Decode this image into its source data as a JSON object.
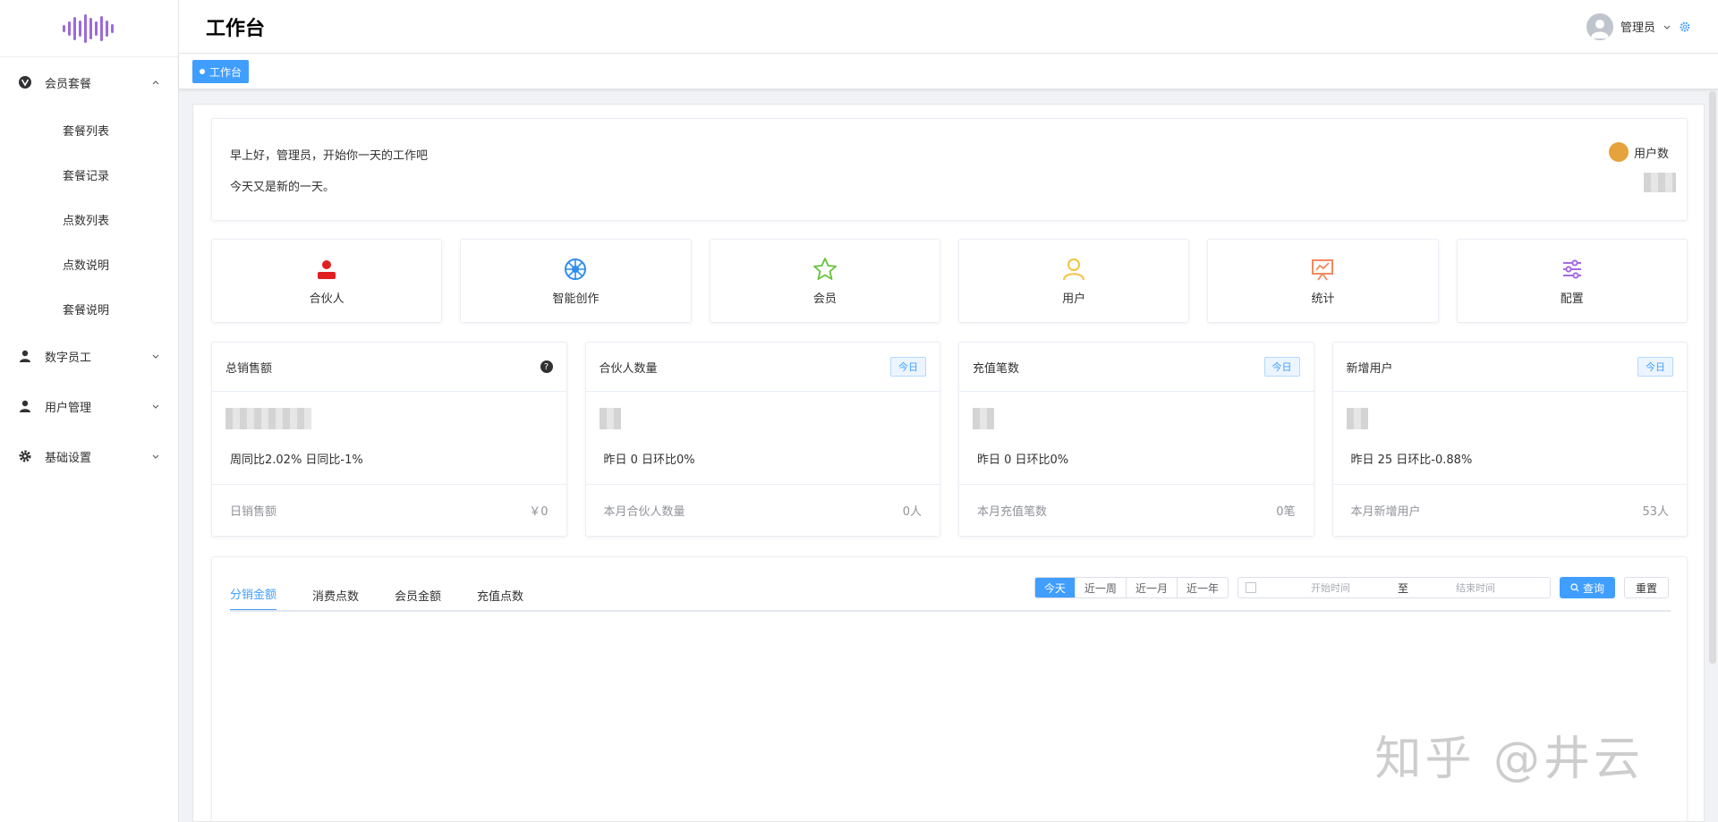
{
  "sidebar": {
    "groups": [
      {
        "label": "会员套餐",
        "icon": "vue-logo-icon",
        "expanded": true,
        "items": [
          {
            "label": "套餐列表"
          },
          {
            "label": "套餐记录"
          },
          {
            "label": "点数列表"
          },
          {
            "label": "点数说明"
          },
          {
            "label": "套餐说明"
          }
        ]
      },
      {
        "label": "数字员工",
        "icon": "user-icon",
        "expanded": false
      },
      {
        "label": "用户管理",
        "icon": "user-icon",
        "expanded": false
      },
      {
        "label": "基础设置",
        "icon": "gear-icon",
        "expanded": false
      }
    ]
  },
  "header": {
    "title": "工作台",
    "user_name": "管理员"
  },
  "tagbar": {
    "active_tag": "工作台"
  },
  "greeting": {
    "line1": "早上好，管理员，开始你一天的工作吧",
    "line2": "今天又是新的一天。",
    "stat_label": "用户数"
  },
  "quick": [
    {
      "label": "合伙人",
      "icon": "partner-icon",
      "color": "#e02020"
    },
    {
      "label": "智能创作",
      "icon": "wheel-icon",
      "color": "#2d8cf0"
    },
    {
      "label": "会员",
      "icon": "star-icon",
      "color": "#67c23a"
    },
    {
      "label": "用户",
      "icon": "user-outline-icon",
      "color": "#f5c242"
    },
    {
      "label": "统计",
      "icon": "presentation-icon",
      "color": "#f08a5d"
    },
    {
      "label": "配置",
      "icon": "sliders-icon",
      "color": "#a46ae0"
    }
  ],
  "stats": [
    {
      "title": "总销售额",
      "badge": "",
      "compare": "周同比2.02%   日同比-1%",
      "foot_label": "日销售额",
      "foot_value": "￥0"
    },
    {
      "title": "合伙人数量",
      "badge": "今日",
      "compare": "昨日 0   日环比0%",
      "foot_label": "本月合伙人数量",
      "foot_value": "0人"
    },
    {
      "title": "充值笔数",
      "badge": "今日",
      "compare": "昨日 0   日环比0%",
      "foot_label": "本月充值笔数",
      "foot_value": "0笔"
    },
    {
      "title": "新增用户",
      "badge": "今日",
      "compare": "昨日 25   日环比-0.88%",
      "foot_label": "本月新增用户",
      "foot_value": "53人"
    }
  ],
  "chart": {
    "tabs": [
      {
        "label": "分销金额"
      },
      {
        "label": "消费点数"
      },
      {
        "label": "会员金额"
      },
      {
        "label": "充值点数"
      }
    ],
    "ranges": [
      {
        "label": "今天"
      },
      {
        "label": "近一周"
      },
      {
        "label": "近一月"
      },
      {
        "label": "近一年"
      }
    ],
    "start_placeholder": "开始时间",
    "separator": "至",
    "end_placeholder": "结束时间",
    "search_label": "查询",
    "reset_label": "重置"
  },
  "watermark": "知乎 @井云",
  "colors": {
    "primary": "#409eff"
  }
}
